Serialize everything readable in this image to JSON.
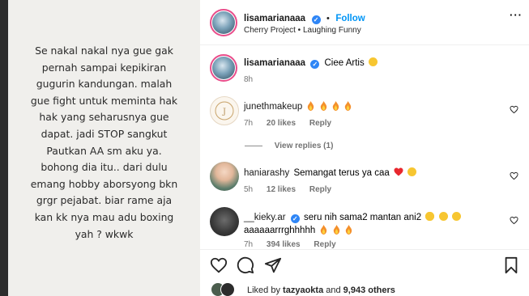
{
  "post": {
    "lines": [
      "Se nakal nakal nya gue gak",
      "pernah sampai kepikiran",
      "gugurin kandungan. malah",
      "gue fight untuk meminta hak",
      "hak yang seharusnya gue",
      "dapat. jadi STOP sangkut",
      "Pautkan AA sm aku ya.",
      "bohong dia itu.. dari dulu",
      "emang hobby aborsyong bkn",
      "grgr pejabat. biar rame aja",
      "kan kk nya mau adu boxing",
      "yah ? wkwk"
    ]
  },
  "header": {
    "username": "lisamarianaaa",
    "separator": "•",
    "follow_label": "Follow",
    "subtitle": "Cherry Project • Laughing Funny",
    "more_label": "···"
  },
  "caption": {
    "username": "lisamarianaaa",
    "text": "Ciee Artis",
    "time": "8h"
  },
  "comments": [
    {
      "username": "junethmakeup",
      "text": "",
      "time": "7h",
      "likes": "20 likes",
      "reply": "Reply",
      "view_replies": "View replies (1)"
    },
    {
      "username": "haniarashy",
      "text": "Semangat terus ya caa",
      "time": "5h",
      "likes": "12 likes",
      "reply": "Reply"
    },
    {
      "username": "__kieky.ar",
      "text": "seru nih sama2 mantan ani2",
      "text2": "aaaaaarrrghhhhh",
      "time": "7h",
      "likes": "394 likes",
      "reply": "Reply"
    }
  ],
  "footer": {
    "liked_prefix": "Liked by",
    "liked_user": "tazyaokta",
    "liked_and": "and",
    "liked_others": "9,943 others"
  },
  "icons": {
    "verified": "verified-badge-icon",
    "heart": "heart-icon",
    "comment": "comment-icon",
    "share": "share-icon",
    "save": "bookmark-icon",
    "more": "more-icon"
  },
  "colors": {
    "follow": "#0095f6",
    "verified": "#2f86f6",
    "meta": "#737373",
    "heart_red": "#ed4956"
  }
}
